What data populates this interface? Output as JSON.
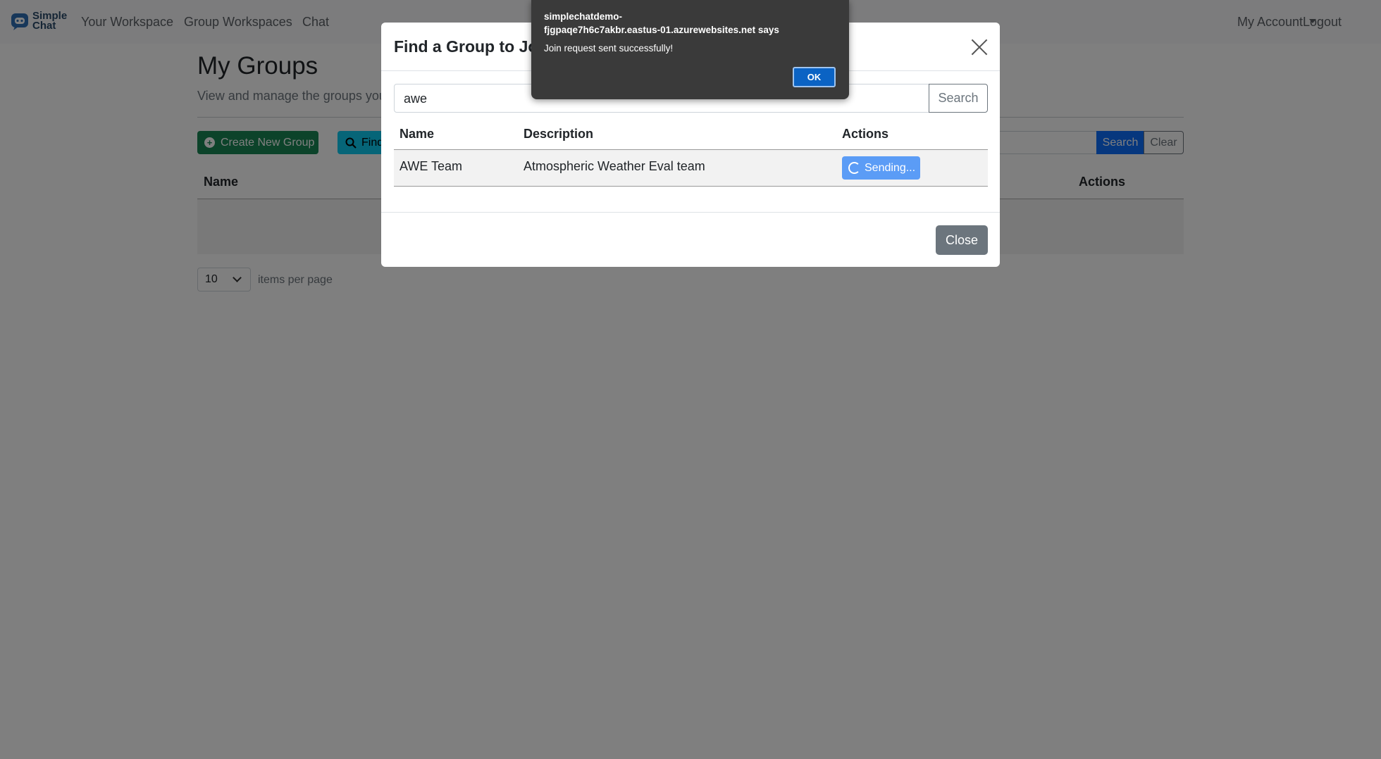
{
  "nav": {
    "brand": "Simple Chat",
    "brand_line1": "Simple",
    "brand_line2": "Chat",
    "your_workspace": "Your Workspace",
    "group_workspaces": "Group Workspaces",
    "chat": "Chat",
    "my_account": "My Account",
    "logout": "Logout"
  },
  "page": {
    "title": "My Groups",
    "subtitle": "View and manage the groups you",
    "create_button": "Create New Group",
    "find_button": "Find",
    "search_button": "Search",
    "clear_button": "Clear",
    "columns": {
      "name": "Name",
      "actions": "Actions"
    },
    "per_page_value": "10",
    "per_page_label": "items per page"
  },
  "modal": {
    "title": "Find a Group to Join",
    "search_value": "awe",
    "search_button": "Search",
    "columns": {
      "name": "Name",
      "description": "Description",
      "actions": "Actions"
    },
    "rows": [
      {
        "name": "AWE Team",
        "description": "Atmospheric Weather Eval team",
        "action": "Sending..."
      }
    ],
    "close_button": "Close"
  },
  "alert": {
    "origin_line1": "simplechatdemo-",
    "origin_line2": "fjgpaqe7h6c7akbr.eastus-01.azurewebsites.net says",
    "message": "Join request sent successfully!",
    "ok": "OK"
  },
  "colors": {
    "success": "#198754",
    "info": "#0dcaf0",
    "primary": "#0d6efd",
    "secondary": "#6c757d",
    "alert_bg": "#3a3a3a"
  }
}
